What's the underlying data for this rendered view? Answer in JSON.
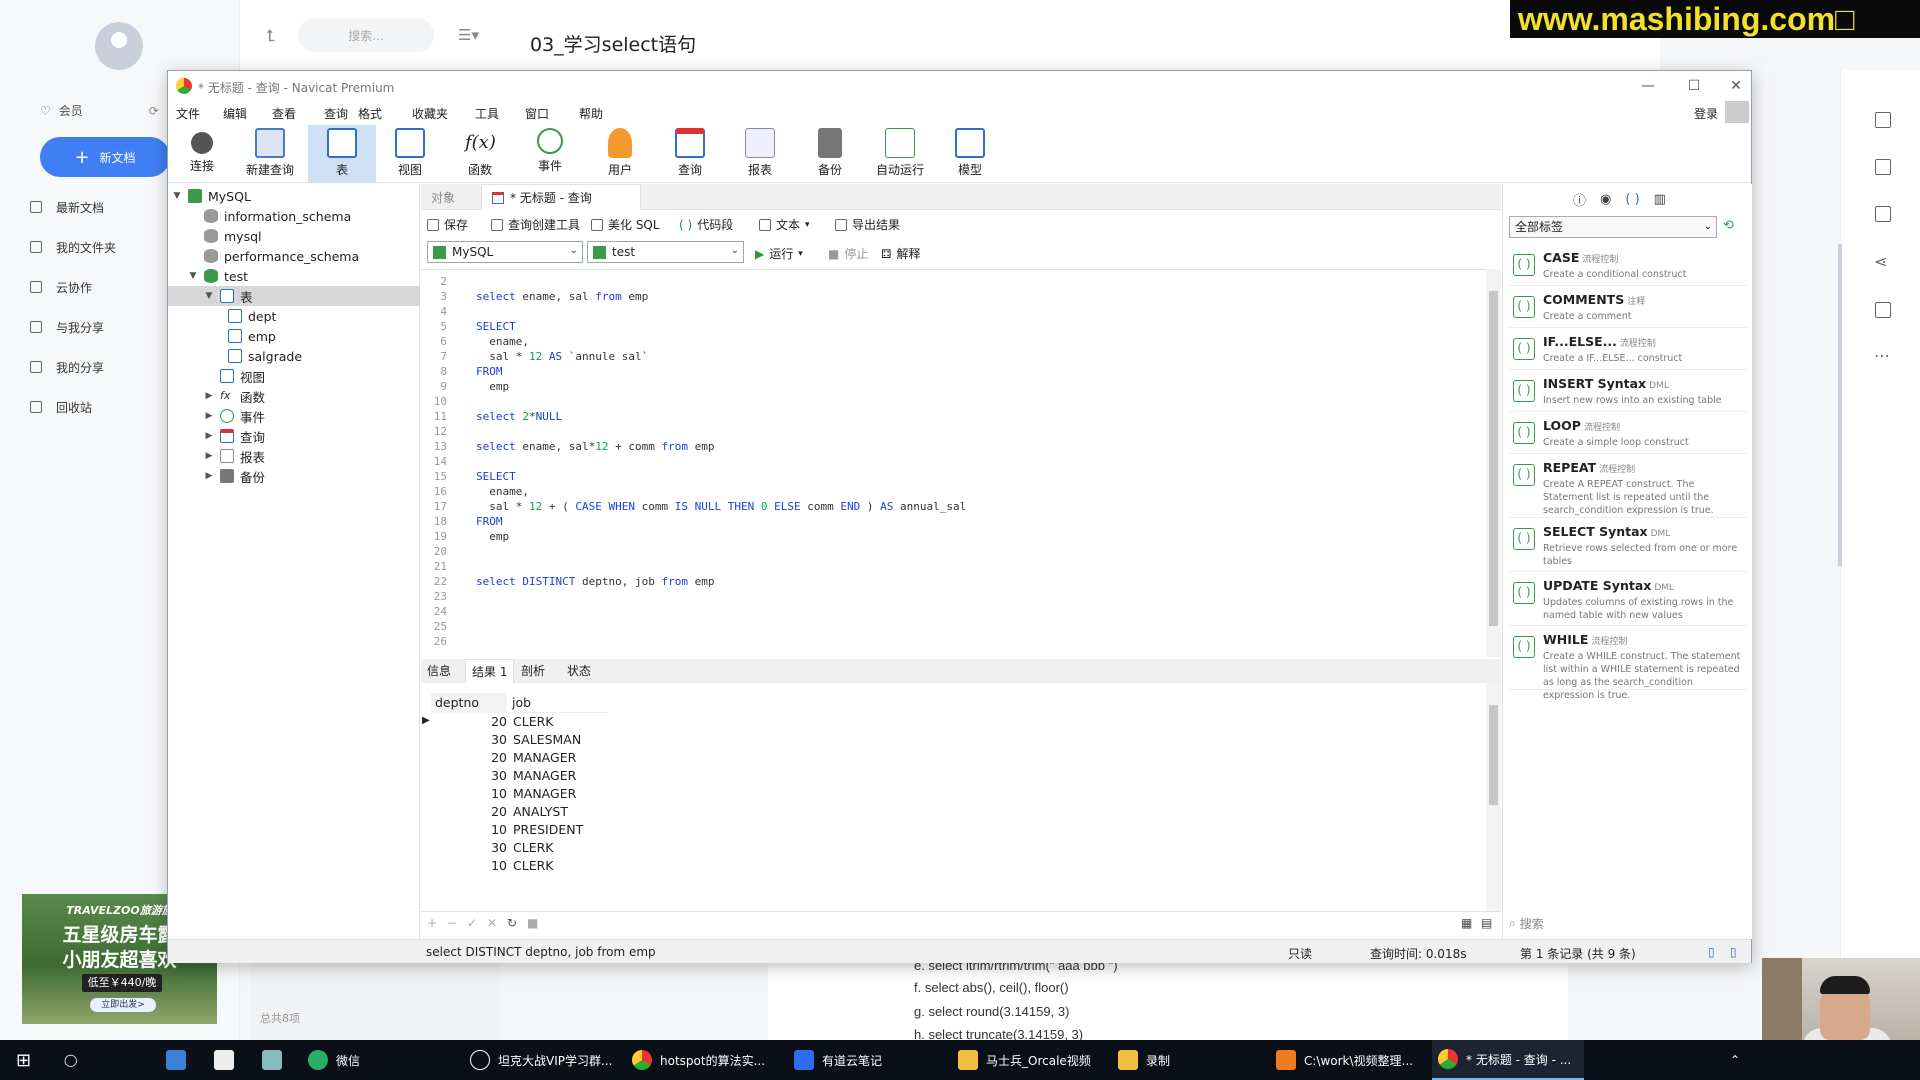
{
  "background_app": {
    "member_label": "会员",
    "new_doc_label": "新文档",
    "search_placeholder": "搜索...",
    "doc_title": "03_学习select语句",
    "nav": [
      "最新文档",
      "我的文件夹",
      "云协作",
      "与我分享",
      "我的分享",
      "回收站"
    ],
    "doc_lines": [
      "e. select ltrim/rtrim/trim(\"  aaa bbb   \")",
      "f. select abs(), ceil(), floor()",
      "g. select round(3.14159, 3)",
      "h. select truncate(3.14159, 3)"
    ],
    "total_label": "总共8项"
  },
  "ad": {
    "brand": "TRAVELZOO旅游族",
    "line1": "五星级房车露",
    "line2": "小朋友超喜欢",
    "price": "低至￥440/晚",
    "cta": "立即出发>"
  },
  "watermark": "www.mashibing.com",
  "window": {
    "title": "* 无标题 - 查询 - Navicat Premium",
    "menu": [
      "文件",
      "编辑",
      "查看",
      "查询",
      "格式",
      "收藏夹",
      "工具",
      "窗口",
      "帮助"
    ],
    "login": "登录",
    "toolbar": [
      {
        "label": "连接",
        "icon": "plug-icon"
      },
      {
        "label": "新建查询",
        "icon": "new-query-icon"
      },
      {
        "label": "表",
        "icon": "table-icon"
      },
      {
        "label": "视图",
        "icon": "view-icon"
      },
      {
        "label": "函数",
        "icon": "function-icon"
      },
      {
        "label": "事件",
        "icon": "clock-icon"
      },
      {
        "label": "用户",
        "icon": "user-icon"
      },
      {
        "label": "查询",
        "icon": "query-icon"
      },
      {
        "label": "报表",
        "icon": "report-icon"
      },
      {
        "label": "备份",
        "icon": "backup-icon"
      },
      {
        "label": "自动运行",
        "icon": "autorun-icon"
      },
      {
        "label": "模型",
        "icon": "model-icon"
      }
    ]
  },
  "tree": {
    "root": "MySQL",
    "databases": [
      "information_schema",
      "mysql",
      "performance_schema",
      "test"
    ],
    "tables_folder": "表",
    "tables": [
      "dept",
      "emp",
      "salgrade"
    ],
    "other_folders": [
      "视图",
      "函数",
      "事件",
      "查询",
      "报表",
      "备份"
    ]
  },
  "editor": {
    "tab_objects": "对象",
    "tab_query": "* 无标题 - 查询",
    "tools": {
      "save": "保存",
      "builder": "查询创建工具",
      "beautify": "美化 SQL",
      "snippet": "代码段",
      "text": "文本",
      "export": "导出结果"
    },
    "connection": "MySQL",
    "database": "test",
    "run": "运行",
    "stop": "停止",
    "explain": "解释",
    "lines": [
      {
        "n": "2",
        "t": ""
      },
      {
        "n": "3",
        "t": "select ename, sal from emp"
      },
      {
        "n": "4",
        "t": ""
      },
      {
        "n": "5",
        "t": "SELECT"
      },
      {
        "n": "6",
        "t": "  ename,"
      },
      {
        "n": "7",
        "t": "  sal * 12 AS `annule sal`"
      },
      {
        "n": "8",
        "t": "FROM"
      },
      {
        "n": "9",
        "t": "  emp"
      },
      {
        "n": "10",
        "t": ""
      },
      {
        "n": "11",
        "t": "select 2*NULL"
      },
      {
        "n": "12",
        "t": ""
      },
      {
        "n": "13",
        "t": "select ename, sal*12 + comm from emp"
      },
      {
        "n": "14",
        "t": ""
      },
      {
        "n": "15",
        "t": "SELECT"
      },
      {
        "n": "16",
        "t": "  ename,"
      },
      {
        "n": "17",
        "t": "  sal * 12 + ( CASE WHEN comm IS NULL THEN 0 ELSE comm END ) AS annual_sal"
      },
      {
        "n": "18",
        "t": "FROM"
      },
      {
        "n": "19",
        "t": "  emp"
      },
      {
        "n": "20",
        "t": ""
      },
      {
        "n": "21",
        "t": ""
      },
      {
        "n": "22",
        "t": "select DISTINCT deptno, job from emp"
      },
      {
        "n": "23",
        "t": ""
      },
      {
        "n": "24",
        "t": ""
      },
      {
        "n": "25",
        "t": ""
      },
      {
        "n": "26",
        "t": ""
      }
    ]
  },
  "results": {
    "tabs": [
      "信息",
      "结果 1",
      "剖析",
      "状态"
    ],
    "columns": [
      "deptno",
      "job"
    ],
    "rows": [
      [
        "20",
        "CLERK"
      ],
      [
        "30",
        "SALESMAN"
      ],
      [
        "20",
        "MANAGER"
      ],
      [
        "30",
        "MANAGER"
      ],
      [
        "10",
        "MANAGER"
      ],
      [
        "20",
        "ANALYST"
      ],
      [
        "10",
        "PRESIDENT"
      ],
      [
        "30",
        "CLERK"
      ],
      [
        "10",
        "CLERK"
      ]
    ]
  },
  "snippets": {
    "filter": "全部标签",
    "search": "搜索",
    "items": [
      {
        "title": "CASE",
        "tag": "流程控制",
        "desc": "Create a conditional construct"
      },
      {
        "title": "COMMENTS",
        "tag": "注释",
        "desc": "Create a comment"
      },
      {
        "title": "IF...ELSE...",
        "tag": "流程控制",
        "desc": "Create a IF...ELSE... construct"
      },
      {
        "title": "INSERT Syntax",
        "tag": "DML",
        "desc": "Insert new rows into an existing table"
      },
      {
        "title": "LOOP",
        "tag": "流程控制",
        "desc": "Create a simple loop construct"
      },
      {
        "title": "REPEAT",
        "tag": "流程控制",
        "desc": "Create A REPEAT construct. The Statement list is repeated until the search_condition expression is true."
      },
      {
        "title": "SELECT Syntax",
        "tag": "DML",
        "desc": "Retrieve rows selected from one or more tables"
      },
      {
        "title": "UPDATE Syntax",
        "tag": "DML",
        "desc": "Updates columns of existing rows in the named table with new values"
      },
      {
        "title": "WHILE",
        "tag": "流程控制",
        "desc": "Create a WHILE construct. The statement list within a WHILE statement is repeated as long as the search_condition expression is true."
      }
    ]
  },
  "status": {
    "sql": "select DISTINCT deptno, job from emp",
    "readonly": "只读",
    "time": "查询时间: 0.018s",
    "record": "第 1 条记录 (共 9 条)"
  },
  "taskbar": {
    "items": [
      "微信",
      "坦克大战VIP学习群...",
      "hotspot的算法实...",
      "有道云笔记",
      "马士兵_Orcale视频",
      "录制",
      "C:\\work\\视频整理...",
      "* 无标题 - 查询 - ..."
    ]
  },
  "colors": {
    "accent": "#3f7ef3",
    "keyword": "#1a3fd6",
    "number": "#0aa34b",
    "selected_tool": "#cfe1f6"
  }
}
